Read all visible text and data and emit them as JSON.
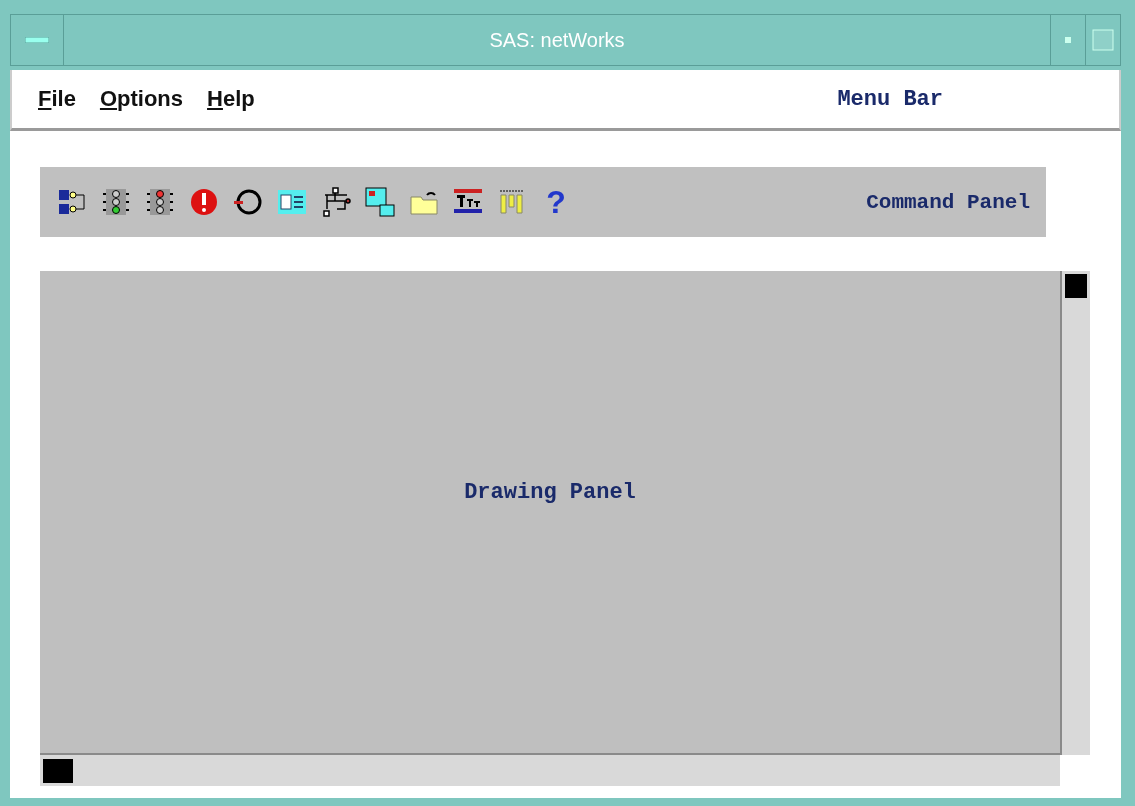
{
  "window": {
    "title": "SAS: netWorks"
  },
  "menu_bar": {
    "items": [
      {
        "label": "File"
      },
      {
        "label": "Options"
      },
      {
        "label": "Help"
      }
    ],
    "caption": "Menu Bar"
  },
  "command_panel": {
    "help_button": "?",
    "caption": "Command Panel"
  },
  "drawing_panel": {
    "caption": "Drawing Panel"
  }
}
